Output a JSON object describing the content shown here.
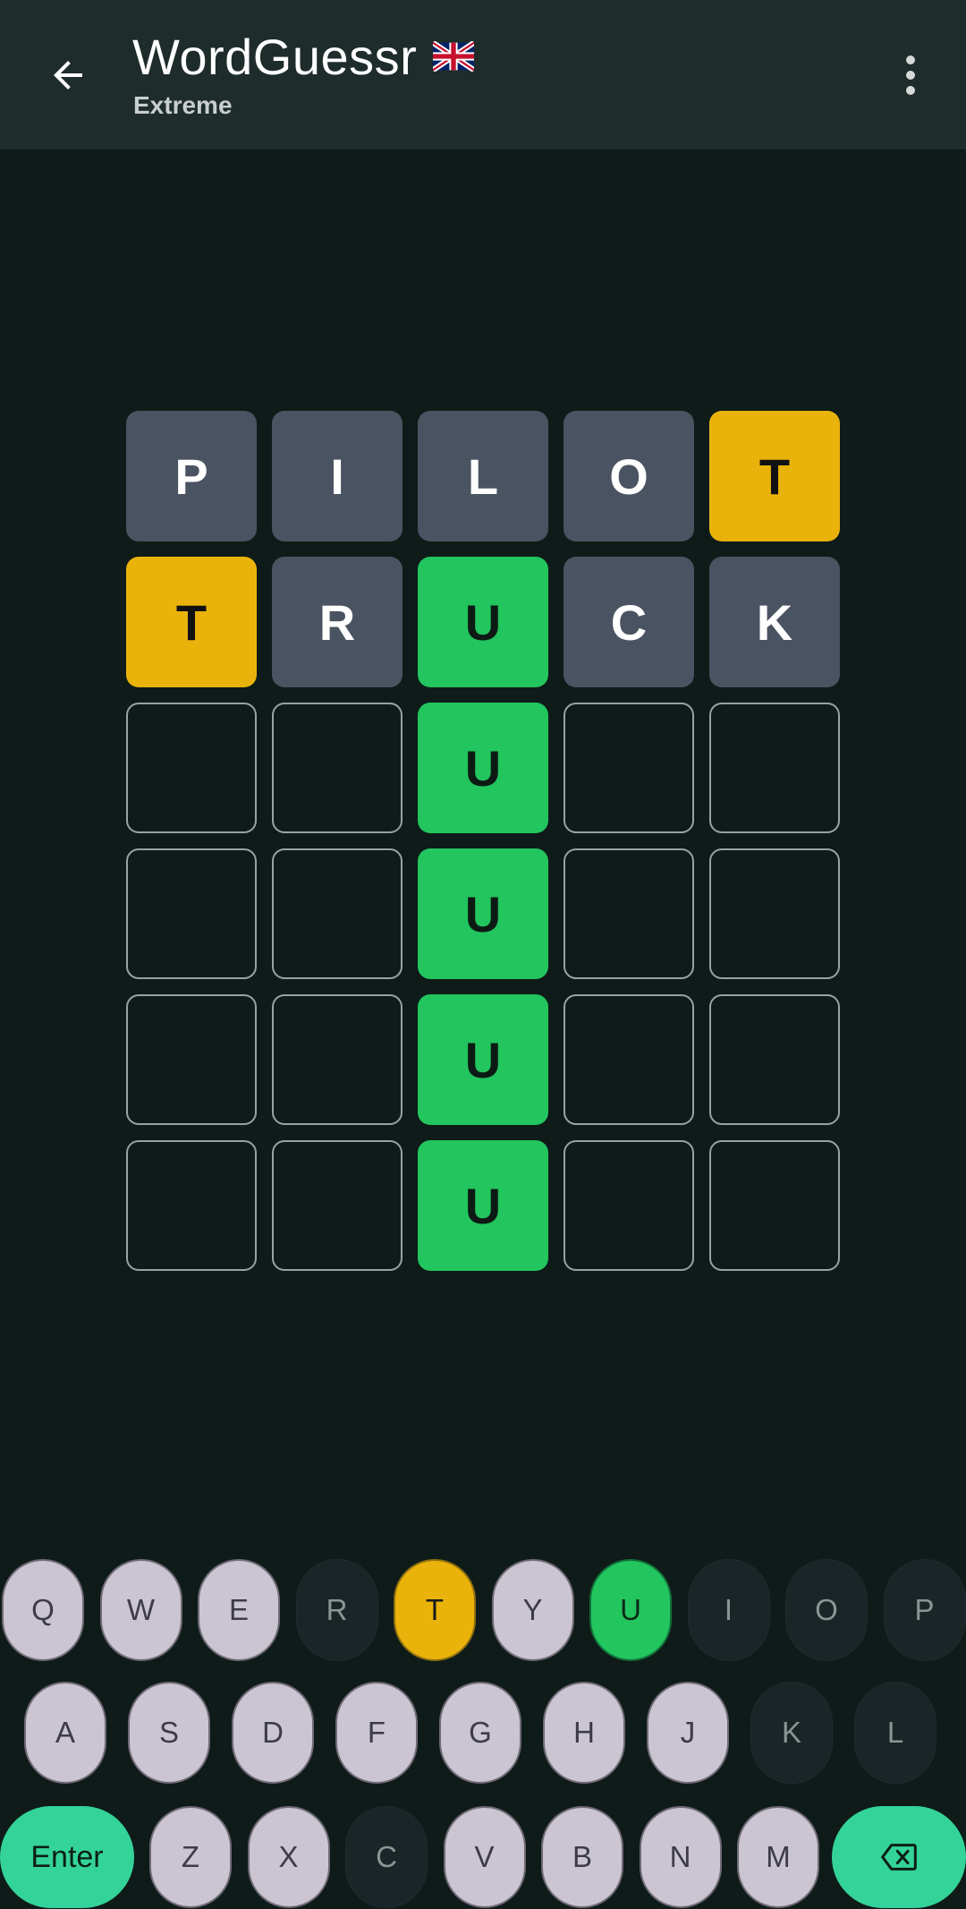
{
  "header": {
    "title": "WordGuessr",
    "subtitle": "Extreme",
    "flag_icon": "uk-flag-icon",
    "back_icon": "arrow-left-icon",
    "menu_icon": "more-vert-icon"
  },
  "board": {
    "rows": [
      [
        {
          "letter": "P",
          "state": "absent"
        },
        {
          "letter": "I",
          "state": "absent"
        },
        {
          "letter": "L",
          "state": "absent"
        },
        {
          "letter": "O",
          "state": "absent"
        },
        {
          "letter": "T",
          "state": "present"
        }
      ],
      [
        {
          "letter": "T",
          "state": "present"
        },
        {
          "letter": "R",
          "state": "absent"
        },
        {
          "letter": "U",
          "state": "correct"
        },
        {
          "letter": "C",
          "state": "absent"
        },
        {
          "letter": "K",
          "state": "absent"
        }
      ],
      [
        {
          "letter": "",
          "state": "empty"
        },
        {
          "letter": "",
          "state": "empty"
        },
        {
          "letter": "U",
          "state": "correct"
        },
        {
          "letter": "",
          "state": "empty"
        },
        {
          "letter": "",
          "state": "empty"
        }
      ],
      [
        {
          "letter": "",
          "state": "empty"
        },
        {
          "letter": "",
          "state": "empty"
        },
        {
          "letter": "U",
          "state": "correct"
        },
        {
          "letter": "",
          "state": "empty"
        },
        {
          "letter": "",
          "state": "empty"
        }
      ],
      [
        {
          "letter": "",
          "state": "empty"
        },
        {
          "letter": "",
          "state": "empty"
        },
        {
          "letter": "U",
          "state": "correct"
        },
        {
          "letter": "",
          "state": "empty"
        },
        {
          "letter": "",
          "state": "empty"
        }
      ],
      [
        {
          "letter": "",
          "state": "empty"
        },
        {
          "letter": "",
          "state": "empty"
        },
        {
          "letter": "U",
          "state": "correct"
        },
        {
          "letter": "",
          "state": "empty"
        },
        {
          "letter": "",
          "state": "empty"
        }
      ]
    ]
  },
  "keyboard": {
    "rows": [
      [
        {
          "label": "Q",
          "state": "unused"
        },
        {
          "label": "W",
          "state": "unused"
        },
        {
          "label": "E",
          "state": "unused"
        },
        {
          "label": "R",
          "state": "absent"
        },
        {
          "label": "T",
          "state": "present"
        },
        {
          "label": "Y",
          "state": "unused"
        },
        {
          "label": "U",
          "state": "correct"
        },
        {
          "label": "I",
          "state": "absent"
        },
        {
          "label": "O",
          "state": "absent"
        },
        {
          "label": "P",
          "state": "absent"
        }
      ],
      [
        {
          "label": "A",
          "state": "unused"
        },
        {
          "label": "S",
          "state": "unused"
        },
        {
          "label": "D",
          "state": "unused"
        },
        {
          "label": "F",
          "state": "unused"
        },
        {
          "label": "G",
          "state": "unused"
        },
        {
          "label": "H",
          "state": "unused"
        },
        {
          "label": "J",
          "state": "unused"
        },
        {
          "label": "K",
          "state": "absent"
        },
        {
          "label": "L",
          "state": "absent"
        }
      ],
      [
        {
          "label": "Enter",
          "state": "action"
        },
        {
          "label": "Z",
          "state": "unused"
        },
        {
          "label": "X",
          "state": "unused"
        },
        {
          "label": "C",
          "state": "absent"
        },
        {
          "label": "V",
          "state": "unused"
        },
        {
          "label": "B",
          "state": "unused"
        },
        {
          "label": "N",
          "state": "unused"
        },
        {
          "label": "M",
          "state": "unused"
        },
        {
          "label": "",
          "state": "action",
          "icon": "backspace-icon"
        }
      ]
    ]
  },
  "colors": {
    "background": "#0e1b19",
    "appbar": "#1e2c2b",
    "absent_tile": "#4a5361",
    "present": "#eab30b",
    "correct": "#22c55e",
    "action_key": "#34d399",
    "unused_key": "#cbc5d2"
  }
}
